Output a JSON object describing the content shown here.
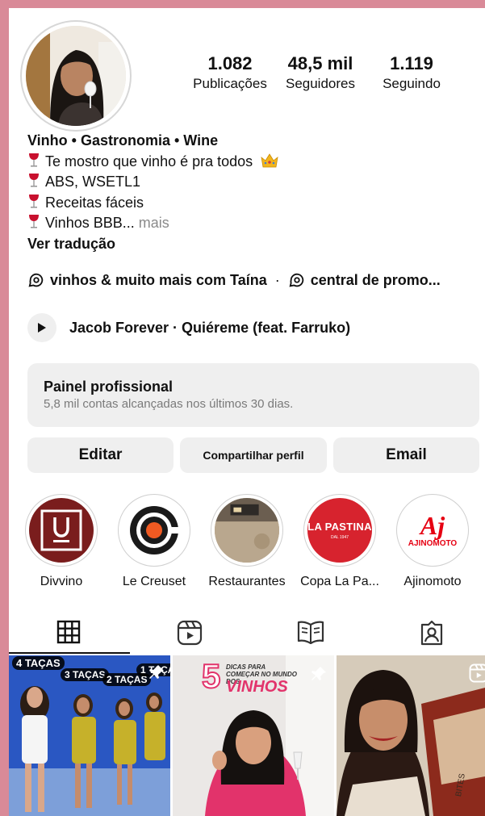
{
  "profile": {
    "stats": {
      "posts": {
        "value": "1.082",
        "label": "Publicações"
      },
      "followers": {
        "value": "48,5 mil",
        "label": "Seguidores"
      },
      "following": {
        "value": "1.119",
        "label": "Seguindo"
      }
    },
    "bio": {
      "name": "Vinho • Gastronomia • Wine",
      "lines": [
        "Te mostro que vinho é pra todos",
        "ABS, WSETL1",
        "Receitas fáceis",
        "Vinhos BBB..."
      ],
      "more_label": "mais",
      "translate_label": "Ver tradução"
    },
    "threads": [
      "vinhos & muito mais com Taína",
      "central de promo..."
    ],
    "threads_separator": "·",
    "music": "Jacob Forever · Quiéreme (feat. Farruko)"
  },
  "panel": {
    "title": "Painel profissional",
    "subtitle": "5,8 mil contas alcançadas nos últimos 30 dias."
  },
  "buttons": {
    "edit": "Editar",
    "share": "Compartilhar perfil",
    "email": "Email"
  },
  "highlights": [
    {
      "label": "Divvino"
    },
    {
      "label": "Le Creuset"
    },
    {
      "label": "Restaurantes"
    },
    {
      "label": "Copa La Pa..."
    },
    {
      "label": "Ajinomoto"
    }
  ],
  "highlight_logos": {
    "la_pastina_line1": "LA PASTINA",
    "la_pastina_line2": "DAL 1947",
    "ajinomoto_mark": "Aj",
    "ajinomoto_word": "AJINOMOTO"
  },
  "tabs": [
    "grid-icon",
    "reels-icon",
    "guide-icon",
    "tagged-icon"
  ],
  "grid": [
    {
      "badges": [
        "4 TAÇAS",
        "3 TAÇAS",
        "2 TAÇAS",
        "1 TAÇA"
      ],
      "pinned": true
    },
    {
      "overlay_number": "5",
      "overlay_small": "DICAS PARA COMEÇAR NO MUNDO DOS",
      "overlay_big": "VINHOS",
      "pinned": true
    },
    {
      "bottle_text": "BITES",
      "reel": true
    }
  ],
  "colors": {
    "background_frame": "#d98a98",
    "divvino": "#7a1d1d",
    "la_pastina": "#d7232e",
    "ajinomoto": "#e60012",
    "le_creuset_orange": "#f05a22",
    "pink_text": "#e2336b"
  }
}
